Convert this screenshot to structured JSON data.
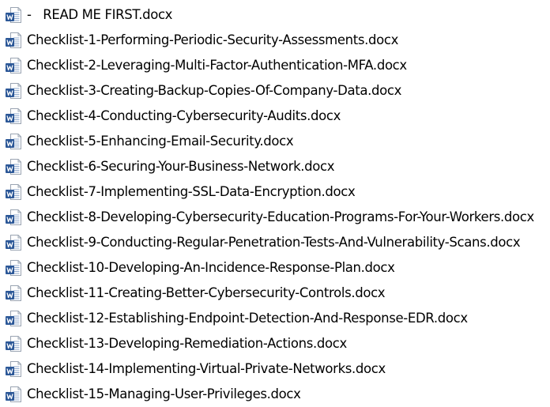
{
  "file_icon": "word-document-icon",
  "icon_colors": {
    "badge": "#2b5797",
    "badge_letter": "#ffffff",
    "page": "#ffffff",
    "page_border": "#9aa4b2",
    "page_lines": "#8fa8cc"
  },
  "files": [
    {
      "name": "-   READ ME FIRST.docx"
    },
    {
      "name": "Checklist-1-Performing-Periodic-Security-Assessments.docx"
    },
    {
      "name": "Checklist-2-Leveraging-Multi-Factor-Authentication-MFA.docx"
    },
    {
      "name": "Checklist-3-Creating-Backup-Copies-Of-Company-Data.docx"
    },
    {
      "name": "Checklist-4-Conducting-Cybersecurity-Audits.docx"
    },
    {
      "name": "Checklist-5-Enhancing-Email-Security.docx"
    },
    {
      "name": "Checklist-6-Securing-Your-Business-Network.docx"
    },
    {
      "name": "Checklist-7-Implementing-SSL-Data-Encryption.docx"
    },
    {
      "name": "Checklist-8-Developing-Cybersecurity-Education-Programs-For-Your-Workers.docx"
    },
    {
      "name": "Checklist-9-Conducting-Regular-Penetration-Tests-And-Vulnerability-Scans.docx"
    },
    {
      "name": "Checklist-10-Developing-An-Incidence-Response-Plan.docx"
    },
    {
      "name": "Checklist-11-Creating-Better-Cybersecurity-Controls.docx"
    },
    {
      "name": "Checklist-12-Establishing-Endpoint-Detection-And-Response-EDR.docx"
    },
    {
      "name": "Checklist-13-Developing-Remediation-Actions.docx"
    },
    {
      "name": "Checklist-14-Implementing-Virtual-Private-Networks.docx"
    },
    {
      "name": "Checklist-15-Managing-User-Privileges.docx"
    }
  ]
}
